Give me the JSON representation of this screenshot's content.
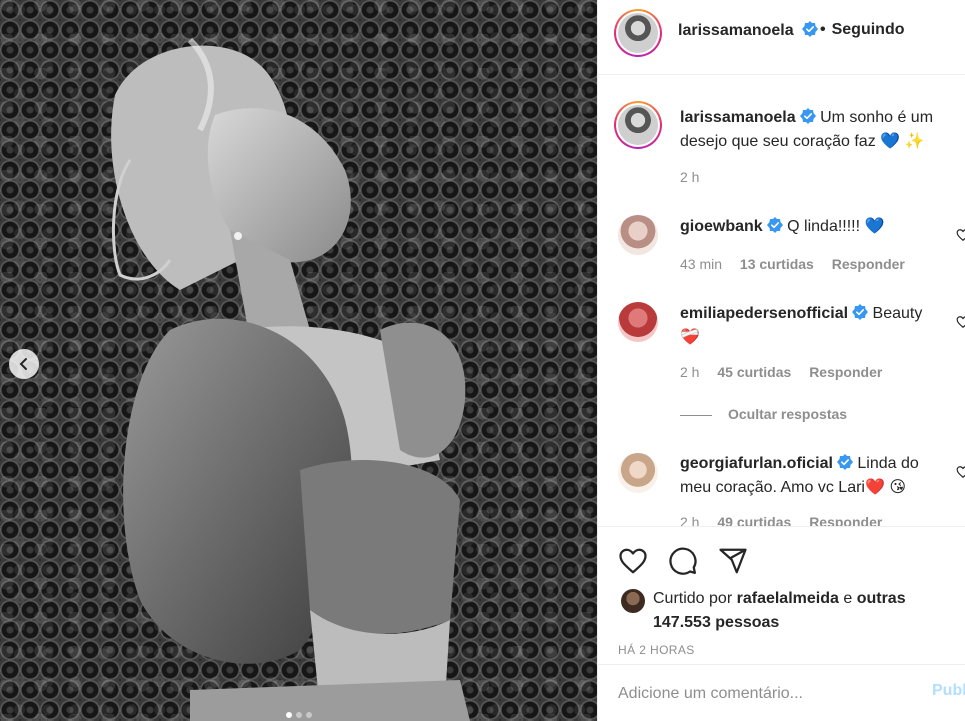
{
  "post": {
    "author": "larissamanoela",
    "follow_status": "Seguindo",
    "carousel_dots": 3,
    "carousel_active_index": 0
  },
  "caption": {
    "username": "larissamanoela",
    "text_line1": "Um sonho é um",
    "text_line2": "desejo que seu coração faz 💙 ✨",
    "time": "2 h"
  },
  "comments": [
    {
      "username": "gioewbank",
      "text": "Q linda!!!!! 💙",
      "time": "43 min",
      "likes": "13 curtidas",
      "reply": "Responder"
    },
    {
      "username": "emiliapedersenofficial",
      "text_line1": "Beauty",
      "text_line2": "❤️‍🩹",
      "time": "2 h",
      "likes": "45 curtidas",
      "reply": "Responder"
    },
    {
      "username": "georgiafurlan.oficial",
      "text_line1": "Linda do",
      "text_line2": "meu coração. Amo vc Lari❤️ 😘",
      "time": "2 h",
      "likes": "49 curtidas",
      "reply": "Responder"
    }
  ],
  "hide_replies": "Ocultar respostas",
  "likes": {
    "prefix": "Curtido por",
    "user": "rafaelalmeida",
    "middle": "e",
    "others": "outras 147.553 pessoas"
  },
  "timestamp": "HÁ 2 HORAS",
  "comment_input": {
    "placeholder": "Adicione um comentário...",
    "publish": "Publ"
  },
  "colors": {
    "verified": "#3897f0",
    "heart": "#ed4956",
    "link": "#0095f6",
    "muted": "#8e8e8e"
  }
}
